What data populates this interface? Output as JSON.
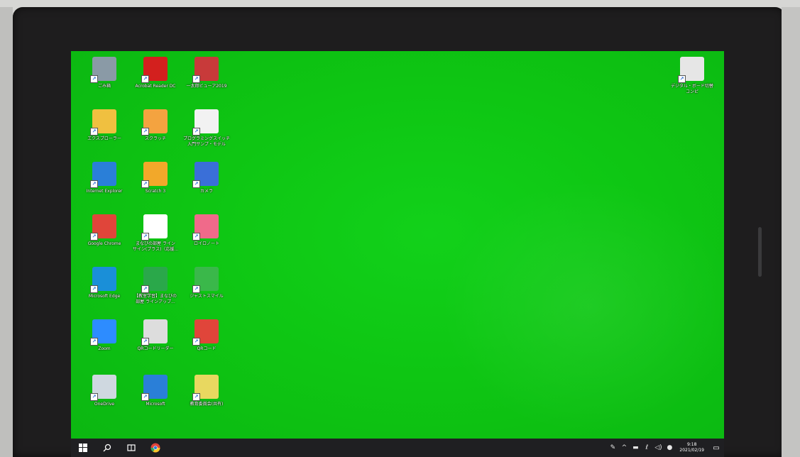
{
  "desktop": {
    "background_color": "#0ec613",
    "icons": [
      {
        "label": "ごみ箱",
        "icon": "recycle-bin",
        "color": "#8a9aa6"
      },
      {
        "label": "Acrobat Reader DC",
        "icon": "acrobat-reader",
        "color": "#d3201e"
      },
      {
        "label": "一太郎ビューア2019",
        "icon": "ichitaro-viewer",
        "color": "#c83a3a"
      },
      {
        "label": "エクスプローラー",
        "icon": "file-explorer",
        "color": "#f0c040"
      },
      {
        "label": "スクラッチ",
        "icon": "scratch-cat",
        "color": "#f4a340"
      },
      {
        "label": "プログラミングスイッチ\n入門サンプ・モデル",
        "icon": "programming-doc",
        "color": "#f2f2f2"
      },
      {
        "label": "Internet Explorer",
        "icon": "internet-explorer",
        "color": "#2a7fd8"
      },
      {
        "label": "Scratch 3",
        "icon": "scratch",
        "color": "#f2a82a"
      },
      {
        "label": "カメラ",
        "icon": "camera",
        "color": "#3a6fd8"
      },
      {
        "label": "Google Chrome",
        "icon": "chrome",
        "color": "#e0453a"
      },
      {
        "label": "まなびの部屋 ライン\nサイン(プラス)（応援...",
        "icon": "learning-app",
        "color": "#ffffff"
      },
      {
        "label": "ロイロノート",
        "icon": "loilo-note",
        "color": "#f06a8a"
      },
      {
        "label": "Microsoft Edge",
        "icon": "edge",
        "color": "#1a8fd8"
      },
      {
        "label": "【教室学習】まなびの\n部屋 ラインアップ...",
        "icon": "learning-app-2",
        "color": "#2aa84a"
      },
      {
        "label": "ジャストスマイル",
        "icon": "just-smile",
        "color": "#3ab84a"
      },
      {
        "label": "Zoom",
        "icon": "zoom",
        "color": "#2d8cff"
      },
      {
        "label": "QRコードリーダー",
        "icon": "qr-reader",
        "color": "#dddddd"
      },
      {
        "label": "QRコード",
        "icon": "qr-chrome",
        "color": "#e0453a"
      },
      {
        "label": "OneDrive",
        "icon": "onedrive",
        "color": "#cfd8e0"
      },
      {
        "label": "Microsoft",
        "icon": "microsoft-store",
        "color": "#2a7fd8"
      },
      {
        "label": "教育委員会(共有)",
        "icon": "shared-folder",
        "color": "#e8d860"
      },
      {
        "label": "デジタル・ボード切替\nコンピ",
        "icon": "digital-board",
        "color": "#e6e6e6"
      }
    ]
  },
  "taskbar": {
    "background_color": "#1f1f22",
    "start_icon": "windows-start-icon",
    "search_icon": "search-icon",
    "task_view_icon": "task-view-icon",
    "chrome_icon": "chrome-icon",
    "tray_icons": [
      "pen-icon",
      "chevron-up-icon",
      "battery-icon",
      "network-icon",
      "volume-icon",
      "info-icon"
    ],
    "time": "9:18",
    "date": "2021/02/19",
    "notification_icon": "notification-icon"
  }
}
